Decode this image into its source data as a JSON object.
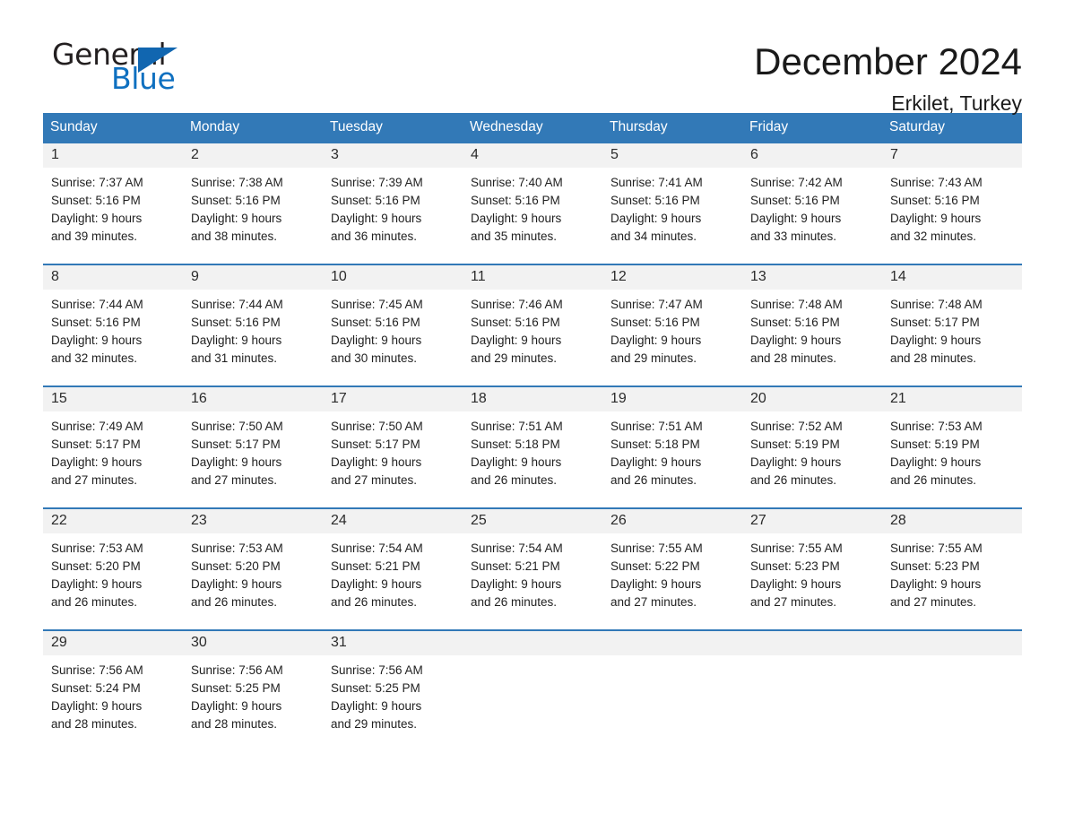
{
  "brand": {
    "word_general": "General",
    "word_blue": "Blue",
    "triangle_color": "#1166b0"
  },
  "header": {
    "month_title": "December 2024",
    "location": "Erkilet, Turkey"
  },
  "theme": {
    "header_bar": "#3279b7",
    "daynum_bg": "#f2f2f2",
    "text": "#1f1f1f"
  },
  "calendar": {
    "weekdays": [
      "Sunday",
      "Monday",
      "Tuesday",
      "Wednesday",
      "Thursday",
      "Friday",
      "Saturday"
    ],
    "weeks": [
      [
        {
          "day": "1",
          "sunrise": "Sunrise: 7:37 AM",
          "sunset": "Sunset: 5:16 PM",
          "daylight1": "Daylight: 9 hours",
          "daylight2": "and 39 minutes."
        },
        {
          "day": "2",
          "sunrise": "Sunrise: 7:38 AM",
          "sunset": "Sunset: 5:16 PM",
          "daylight1": "Daylight: 9 hours",
          "daylight2": "and 38 minutes."
        },
        {
          "day": "3",
          "sunrise": "Sunrise: 7:39 AM",
          "sunset": "Sunset: 5:16 PM",
          "daylight1": "Daylight: 9 hours",
          "daylight2": "and 36 minutes."
        },
        {
          "day": "4",
          "sunrise": "Sunrise: 7:40 AM",
          "sunset": "Sunset: 5:16 PM",
          "daylight1": "Daylight: 9 hours",
          "daylight2": "and 35 minutes."
        },
        {
          "day": "5",
          "sunrise": "Sunrise: 7:41 AM",
          "sunset": "Sunset: 5:16 PM",
          "daylight1": "Daylight: 9 hours",
          "daylight2": "and 34 minutes."
        },
        {
          "day": "6",
          "sunrise": "Sunrise: 7:42 AM",
          "sunset": "Sunset: 5:16 PM",
          "daylight1": "Daylight: 9 hours",
          "daylight2": "and 33 minutes."
        },
        {
          "day": "7",
          "sunrise": "Sunrise: 7:43 AM",
          "sunset": "Sunset: 5:16 PM",
          "daylight1": "Daylight: 9 hours",
          "daylight2": "and 32 minutes."
        }
      ],
      [
        {
          "day": "8",
          "sunrise": "Sunrise: 7:44 AM",
          "sunset": "Sunset: 5:16 PM",
          "daylight1": "Daylight: 9 hours",
          "daylight2": "and 32 minutes."
        },
        {
          "day": "9",
          "sunrise": "Sunrise: 7:44 AM",
          "sunset": "Sunset: 5:16 PM",
          "daylight1": "Daylight: 9 hours",
          "daylight2": "and 31 minutes."
        },
        {
          "day": "10",
          "sunrise": "Sunrise: 7:45 AM",
          "sunset": "Sunset: 5:16 PM",
          "daylight1": "Daylight: 9 hours",
          "daylight2": "and 30 minutes."
        },
        {
          "day": "11",
          "sunrise": "Sunrise: 7:46 AM",
          "sunset": "Sunset: 5:16 PM",
          "daylight1": "Daylight: 9 hours",
          "daylight2": "and 29 minutes."
        },
        {
          "day": "12",
          "sunrise": "Sunrise: 7:47 AM",
          "sunset": "Sunset: 5:16 PM",
          "daylight1": "Daylight: 9 hours",
          "daylight2": "and 29 minutes."
        },
        {
          "day": "13",
          "sunrise": "Sunrise: 7:48 AM",
          "sunset": "Sunset: 5:16 PM",
          "daylight1": "Daylight: 9 hours",
          "daylight2": "and 28 minutes."
        },
        {
          "day": "14",
          "sunrise": "Sunrise: 7:48 AM",
          "sunset": "Sunset: 5:17 PM",
          "daylight1": "Daylight: 9 hours",
          "daylight2": "and 28 minutes."
        }
      ],
      [
        {
          "day": "15",
          "sunrise": "Sunrise: 7:49 AM",
          "sunset": "Sunset: 5:17 PM",
          "daylight1": "Daylight: 9 hours",
          "daylight2": "and 27 minutes."
        },
        {
          "day": "16",
          "sunrise": "Sunrise: 7:50 AM",
          "sunset": "Sunset: 5:17 PM",
          "daylight1": "Daylight: 9 hours",
          "daylight2": "and 27 minutes."
        },
        {
          "day": "17",
          "sunrise": "Sunrise: 7:50 AM",
          "sunset": "Sunset: 5:17 PM",
          "daylight1": "Daylight: 9 hours",
          "daylight2": "and 27 minutes."
        },
        {
          "day": "18",
          "sunrise": "Sunrise: 7:51 AM",
          "sunset": "Sunset: 5:18 PM",
          "daylight1": "Daylight: 9 hours",
          "daylight2": "and 26 minutes."
        },
        {
          "day": "19",
          "sunrise": "Sunrise: 7:51 AM",
          "sunset": "Sunset: 5:18 PM",
          "daylight1": "Daylight: 9 hours",
          "daylight2": "and 26 minutes."
        },
        {
          "day": "20",
          "sunrise": "Sunrise: 7:52 AM",
          "sunset": "Sunset: 5:19 PM",
          "daylight1": "Daylight: 9 hours",
          "daylight2": "and 26 minutes."
        },
        {
          "day": "21",
          "sunrise": "Sunrise: 7:53 AM",
          "sunset": "Sunset: 5:19 PM",
          "daylight1": "Daylight: 9 hours",
          "daylight2": "and 26 minutes."
        }
      ],
      [
        {
          "day": "22",
          "sunrise": "Sunrise: 7:53 AM",
          "sunset": "Sunset: 5:20 PM",
          "daylight1": "Daylight: 9 hours",
          "daylight2": "and 26 minutes."
        },
        {
          "day": "23",
          "sunrise": "Sunrise: 7:53 AM",
          "sunset": "Sunset: 5:20 PM",
          "daylight1": "Daylight: 9 hours",
          "daylight2": "and 26 minutes."
        },
        {
          "day": "24",
          "sunrise": "Sunrise: 7:54 AM",
          "sunset": "Sunset: 5:21 PM",
          "daylight1": "Daylight: 9 hours",
          "daylight2": "and 26 minutes."
        },
        {
          "day": "25",
          "sunrise": "Sunrise: 7:54 AM",
          "sunset": "Sunset: 5:21 PM",
          "daylight1": "Daylight: 9 hours",
          "daylight2": "and 26 minutes."
        },
        {
          "day": "26",
          "sunrise": "Sunrise: 7:55 AM",
          "sunset": "Sunset: 5:22 PM",
          "daylight1": "Daylight: 9 hours",
          "daylight2": "and 27 minutes."
        },
        {
          "day": "27",
          "sunrise": "Sunrise: 7:55 AM",
          "sunset": "Sunset: 5:23 PM",
          "daylight1": "Daylight: 9 hours",
          "daylight2": "and 27 minutes."
        },
        {
          "day": "28",
          "sunrise": "Sunrise: 7:55 AM",
          "sunset": "Sunset: 5:23 PM",
          "daylight1": "Daylight: 9 hours",
          "daylight2": "and 27 minutes."
        }
      ],
      [
        {
          "day": "29",
          "sunrise": "Sunrise: 7:56 AM",
          "sunset": "Sunset: 5:24 PM",
          "daylight1": "Daylight: 9 hours",
          "daylight2": "and 28 minutes."
        },
        {
          "day": "30",
          "sunrise": "Sunrise: 7:56 AM",
          "sunset": "Sunset: 5:25 PM",
          "daylight1": "Daylight: 9 hours",
          "daylight2": "and 28 minutes."
        },
        {
          "day": "31",
          "sunrise": "Sunrise: 7:56 AM",
          "sunset": "Sunset: 5:25 PM",
          "daylight1": "Daylight: 9 hours",
          "daylight2": "and 29 minutes."
        },
        {
          "day": "",
          "sunrise": "",
          "sunset": "",
          "daylight1": "",
          "daylight2": ""
        },
        {
          "day": "",
          "sunrise": "",
          "sunset": "",
          "daylight1": "",
          "daylight2": ""
        },
        {
          "day": "",
          "sunrise": "",
          "sunset": "",
          "daylight1": "",
          "daylight2": ""
        },
        {
          "day": "",
          "sunrise": "",
          "sunset": "",
          "daylight1": "",
          "daylight2": ""
        }
      ]
    ]
  }
}
